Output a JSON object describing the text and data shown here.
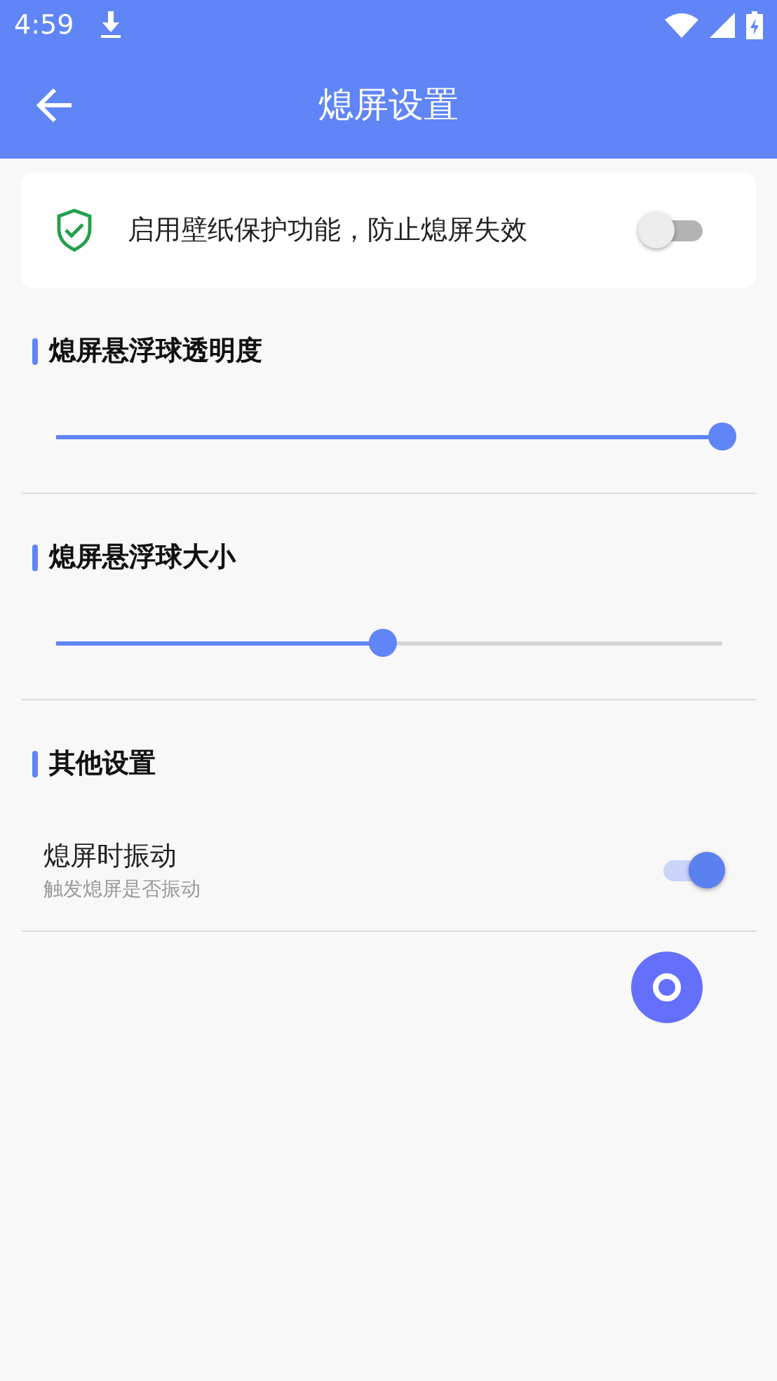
{
  "status_bar": {
    "time": "4:59"
  },
  "app_bar": {
    "title": "熄屏设置"
  },
  "protection": {
    "label": "启用壁纸保护功能，防止熄屏失效",
    "on": false
  },
  "sliders": [
    {
      "title": "熄屏悬浮球透明度",
      "level": 1.0
    },
    {
      "title": "熄屏悬浮球大小",
      "level": 0.49
    }
  ],
  "other": {
    "title": "其他设置",
    "items": [
      {
        "title": "熄屏时振动",
        "subtitle": "触发熄屏是否振动",
        "on": true
      }
    ]
  }
}
